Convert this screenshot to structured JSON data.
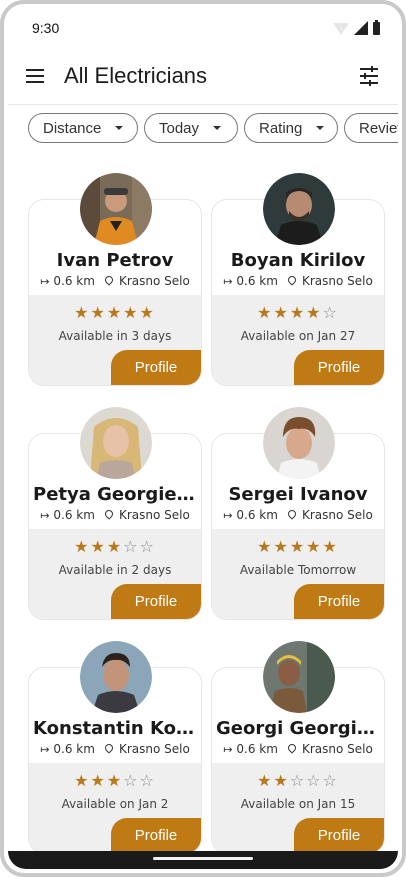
{
  "status": {
    "time": "9:30"
  },
  "appbar": {
    "title": "All Electricians"
  },
  "filters": [
    {
      "label": "Distance"
    },
    {
      "label": "Today"
    },
    {
      "label": "Rating"
    },
    {
      "label": "Review"
    }
  ],
  "card_common": {
    "profile_label": "Profile",
    "distance_arrow": "↦"
  },
  "electricians": [
    {
      "name": "Ivan Petrov",
      "distance": "0.6 km",
      "location": "Krasno Selo",
      "rating": 5,
      "availability": "Available in 3 days"
    },
    {
      "name": "Boyan Kirilov",
      "distance": "0.6 km",
      "location": "Krasno Selo",
      "rating": 4,
      "availability": "Available on Jan 27"
    },
    {
      "name": "Petya Georgieva",
      "distance": "0.6 km",
      "location": "Krasno Selo",
      "rating": 3,
      "availability": "Available in 2 days"
    },
    {
      "name": "Sergei Ivanov",
      "distance": "0.6 km",
      "location": "Krasno Selo",
      "rating": 5,
      "availability": "Available Tomorrow"
    },
    {
      "name": "Konstantin Kons…",
      "distance": "0.6 km",
      "location": "Krasno Selo",
      "rating": 3,
      "availability": "Available on Jan 2"
    },
    {
      "name": "Georgi Georgiev",
      "distance": "0.6 km",
      "location": "Krasno Selo",
      "rating": 2,
      "availability": "Available on Jan 15"
    }
  ],
  "colors": {
    "accent": "#bf7a14",
    "star": "#b8791c",
    "card_bottom": "#efefef"
  }
}
